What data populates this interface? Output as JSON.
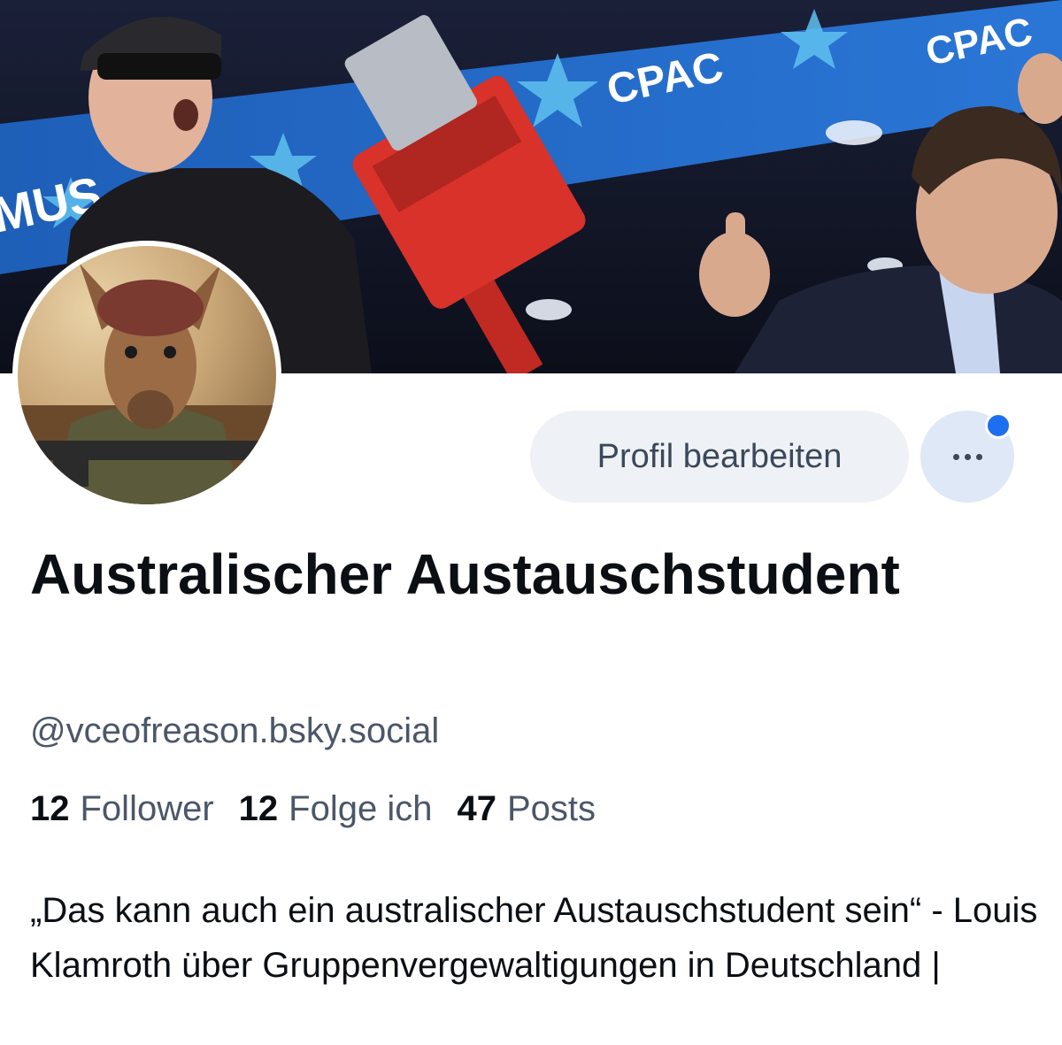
{
  "profile": {
    "display_name": "Australischer Austauschstudent",
    "handle": "@vceofreason.bsky.social",
    "bio": "„Das kann auch ein australischer Austauschstudent sein“ - Louis Klamroth über Gruppenvergewaltigungen in Deutschland |"
  },
  "stats": [
    {
      "count": "12",
      "label": "Follower"
    },
    {
      "count": "12",
      "label": "Folge ich"
    },
    {
      "count": "47",
      "label": "Posts"
    }
  ],
  "actions": {
    "edit_label": "Profil bearbeiten",
    "more_icon": "ellipsis-icon",
    "notification_dot": true
  },
  "banner": {
    "signage_text": [
      "CPAC",
      "CPAC",
      "MUS"
    ]
  },
  "colors": {
    "accent": "#1d6ff2",
    "text": "#0b0f14",
    "muted": "#4b5768",
    "button_bg": "#eef2f7"
  }
}
